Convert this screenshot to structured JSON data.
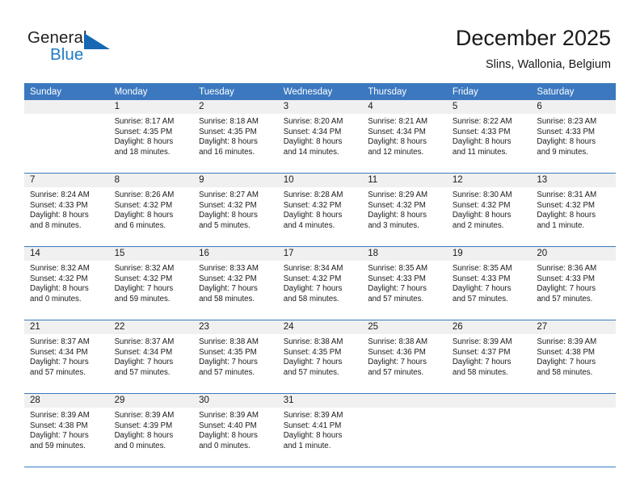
{
  "brand": {
    "name_top": "General",
    "name_bottom": "Blue",
    "triangle_color": "#1668b3",
    "blue_color": "#1f7ac4"
  },
  "header": {
    "title": "December 2025",
    "subtitle": "Slins, Wallonia, Belgium"
  },
  "theme": {
    "header_row_bg": "#3b78bf",
    "daynum_bg": "#f0f0f0",
    "row_divider": "#3b78bf",
    "text": "#1a1a1a"
  },
  "calendar": {
    "weekdays": [
      "Sunday",
      "Monday",
      "Tuesday",
      "Wednesday",
      "Thursday",
      "Friday",
      "Saturday"
    ],
    "weeks": [
      [
        {
          "day": "",
          "sunrise": "",
          "sunset": "",
          "daylight_line1": "",
          "daylight_line2": ""
        },
        {
          "day": "1",
          "sunrise": "Sunrise: 8:17 AM",
          "sunset": "Sunset: 4:35 PM",
          "daylight_line1": "Daylight: 8 hours",
          "daylight_line2": "and 18 minutes."
        },
        {
          "day": "2",
          "sunrise": "Sunrise: 8:18 AM",
          "sunset": "Sunset: 4:35 PM",
          "daylight_line1": "Daylight: 8 hours",
          "daylight_line2": "and 16 minutes."
        },
        {
          "day": "3",
          "sunrise": "Sunrise: 8:20 AM",
          "sunset": "Sunset: 4:34 PM",
          "daylight_line1": "Daylight: 8 hours",
          "daylight_line2": "and 14 minutes."
        },
        {
          "day": "4",
          "sunrise": "Sunrise: 8:21 AM",
          "sunset": "Sunset: 4:34 PM",
          "daylight_line1": "Daylight: 8 hours",
          "daylight_line2": "and 12 minutes."
        },
        {
          "day": "5",
          "sunrise": "Sunrise: 8:22 AM",
          "sunset": "Sunset: 4:33 PM",
          "daylight_line1": "Daylight: 8 hours",
          "daylight_line2": "and 11 minutes."
        },
        {
          "day": "6",
          "sunrise": "Sunrise: 8:23 AM",
          "sunset": "Sunset: 4:33 PM",
          "daylight_line1": "Daylight: 8 hours",
          "daylight_line2": "and 9 minutes."
        }
      ],
      [
        {
          "day": "7",
          "sunrise": "Sunrise: 8:24 AM",
          "sunset": "Sunset: 4:33 PM",
          "daylight_line1": "Daylight: 8 hours",
          "daylight_line2": "and 8 minutes."
        },
        {
          "day": "8",
          "sunrise": "Sunrise: 8:26 AM",
          "sunset": "Sunset: 4:32 PM",
          "daylight_line1": "Daylight: 8 hours",
          "daylight_line2": "and 6 minutes."
        },
        {
          "day": "9",
          "sunrise": "Sunrise: 8:27 AM",
          "sunset": "Sunset: 4:32 PM",
          "daylight_line1": "Daylight: 8 hours",
          "daylight_line2": "and 5 minutes."
        },
        {
          "day": "10",
          "sunrise": "Sunrise: 8:28 AM",
          "sunset": "Sunset: 4:32 PM",
          "daylight_line1": "Daylight: 8 hours",
          "daylight_line2": "and 4 minutes."
        },
        {
          "day": "11",
          "sunrise": "Sunrise: 8:29 AM",
          "sunset": "Sunset: 4:32 PM",
          "daylight_line1": "Daylight: 8 hours",
          "daylight_line2": "and 3 minutes."
        },
        {
          "day": "12",
          "sunrise": "Sunrise: 8:30 AM",
          "sunset": "Sunset: 4:32 PM",
          "daylight_line1": "Daylight: 8 hours",
          "daylight_line2": "and 2 minutes."
        },
        {
          "day": "13",
          "sunrise": "Sunrise: 8:31 AM",
          "sunset": "Sunset: 4:32 PM",
          "daylight_line1": "Daylight: 8 hours",
          "daylight_line2": "and 1 minute."
        }
      ],
      [
        {
          "day": "14",
          "sunrise": "Sunrise: 8:32 AM",
          "sunset": "Sunset: 4:32 PM",
          "daylight_line1": "Daylight: 8 hours",
          "daylight_line2": "and 0 minutes."
        },
        {
          "day": "15",
          "sunrise": "Sunrise: 8:32 AM",
          "sunset": "Sunset: 4:32 PM",
          "daylight_line1": "Daylight: 7 hours",
          "daylight_line2": "and 59 minutes."
        },
        {
          "day": "16",
          "sunrise": "Sunrise: 8:33 AM",
          "sunset": "Sunset: 4:32 PM",
          "daylight_line1": "Daylight: 7 hours",
          "daylight_line2": "and 58 minutes."
        },
        {
          "day": "17",
          "sunrise": "Sunrise: 8:34 AM",
          "sunset": "Sunset: 4:32 PM",
          "daylight_line1": "Daylight: 7 hours",
          "daylight_line2": "and 58 minutes."
        },
        {
          "day": "18",
          "sunrise": "Sunrise: 8:35 AM",
          "sunset": "Sunset: 4:33 PM",
          "daylight_line1": "Daylight: 7 hours",
          "daylight_line2": "and 57 minutes."
        },
        {
          "day": "19",
          "sunrise": "Sunrise: 8:35 AM",
          "sunset": "Sunset: 4:33 PM",
          "daylight_line1": "Daylight: 7 hours",
          "daylight_line2": "and 57 minutes."
        },
        {
          "day": "20",
          "sunrise": "Sunrise: 8:36 AM",
          "sunset": "Sunset: 4:33 PM",
          "daylight_line1": "Daylight: 7 hours",
          "daylight_line2": "and 57 minutes."
        }
      ],
      [
        {
          "day": "21",
          "sunrise": "Sunrise: 8:37 AM",
          "sunset": "Sunset: 4:34 PM",
          "daylight_line1": "Daylight: 7 hours",
          "daylight_line2": "and 57 minutes."
        },
        {
          "day": "22",
          "sunrise": "Sunrise: 8:37 AM",
          "sunset": "Sunset: 4:34 PM",
          "daylight_line1": "Daylight: 7 hours",
          "daylight_line2": "and 57 minutes."
        },
        {
          "day": "23",
          "sunrise": "Sunrise: 8:38 AM",
          "sunset": "Sunset: 4:35 PM",
          "daylight_line1": "Daylight: 7 hours",
          "daylight_line2": "and 57 minutes."
        },
        {
          "day": "24",
          "sunrise": "Sunrise: 8:38 AM",
          "sunset": "Sunset: 4:35 PM",
          "daylight_line1": "Daylight: 7 hours",
          "daylight_line2": "and 57 minutes."
        },
        {
          "day": "25",
          "sunrise": "Sunrise: 8:38 AM",
          "sunset": "Sunset: 4:36 PM",
          "daylight_line1": "Daylight: 7 hours",
          "daylight_line2": "and 57 minutes."
        },
        {
          "day": "26",
          "sunrise": "Sunrise: 8:39 AM",
          "sunset": "Sunset: 4:37 PM",
          "daylight_line1": "Daylight: 7 hours",
          "daylight_line2": "and 58 minutes."
        },
        {
          "day": "27",
          "sunrise": "Sunrise: 8:39 AM",
          "sunset": "Sunset: 4:38 PM",
          "daylight_line1": "Daylight: 7 hours",
          "daylight_line2": "and 58 minutes."
        }
      ],
      [
        {
          "day": "28",
          "sunrise": "Sunrise: 8:39 AM",
          "sunset": "Sunset: 4:38 PM",
          "daylight_line1": "Daylight: 7 hours",
          "daylight_line2": "and 59 minutes."
        },
        {
          "day": "29",
          "sunrise": "Sunrise: 8:39 AM",
          "sunset": "Sunset: 4:39 PM",
          "daylight_line1": "Daylight: 8 hours",
          "daylight_line2": "and 0 minutes."
        },
        {
          "day": "30",
          "sunrise": "Sunrise: 8:39 AM",
          "sunset": "Sunset: 4:40 PM",
          "daylight_line1": "Daylight: 8 hours",
          "daylight_line2": "and 0 minutes."
        },
        {
          "day": "31",
          "sunrise": "Sunrise: 8:39 AM",
          "sunset": "Sunset: 4:41 PM",
          "daylight_line1": "Daylight: 8 hours",
          "daylight_line2": "and 1 minute."
        },
        {
          "day": "",
          "sunrise": "",
          "sunset": "",
          "daylight_line1": "",
          "daylight_line2": ""
        },
        {
          "day": "",
          "sunrise": "",
          "sunset": "",
          "daylight_line1": "",
          "daylight_line2": ""
        },
        {
          "day": "",
          "sunrise": "",
          "sunset": "",
          "daylight_line1": "",
          "daylight_line2": ""
        }
      ]
    ]
  }
}
